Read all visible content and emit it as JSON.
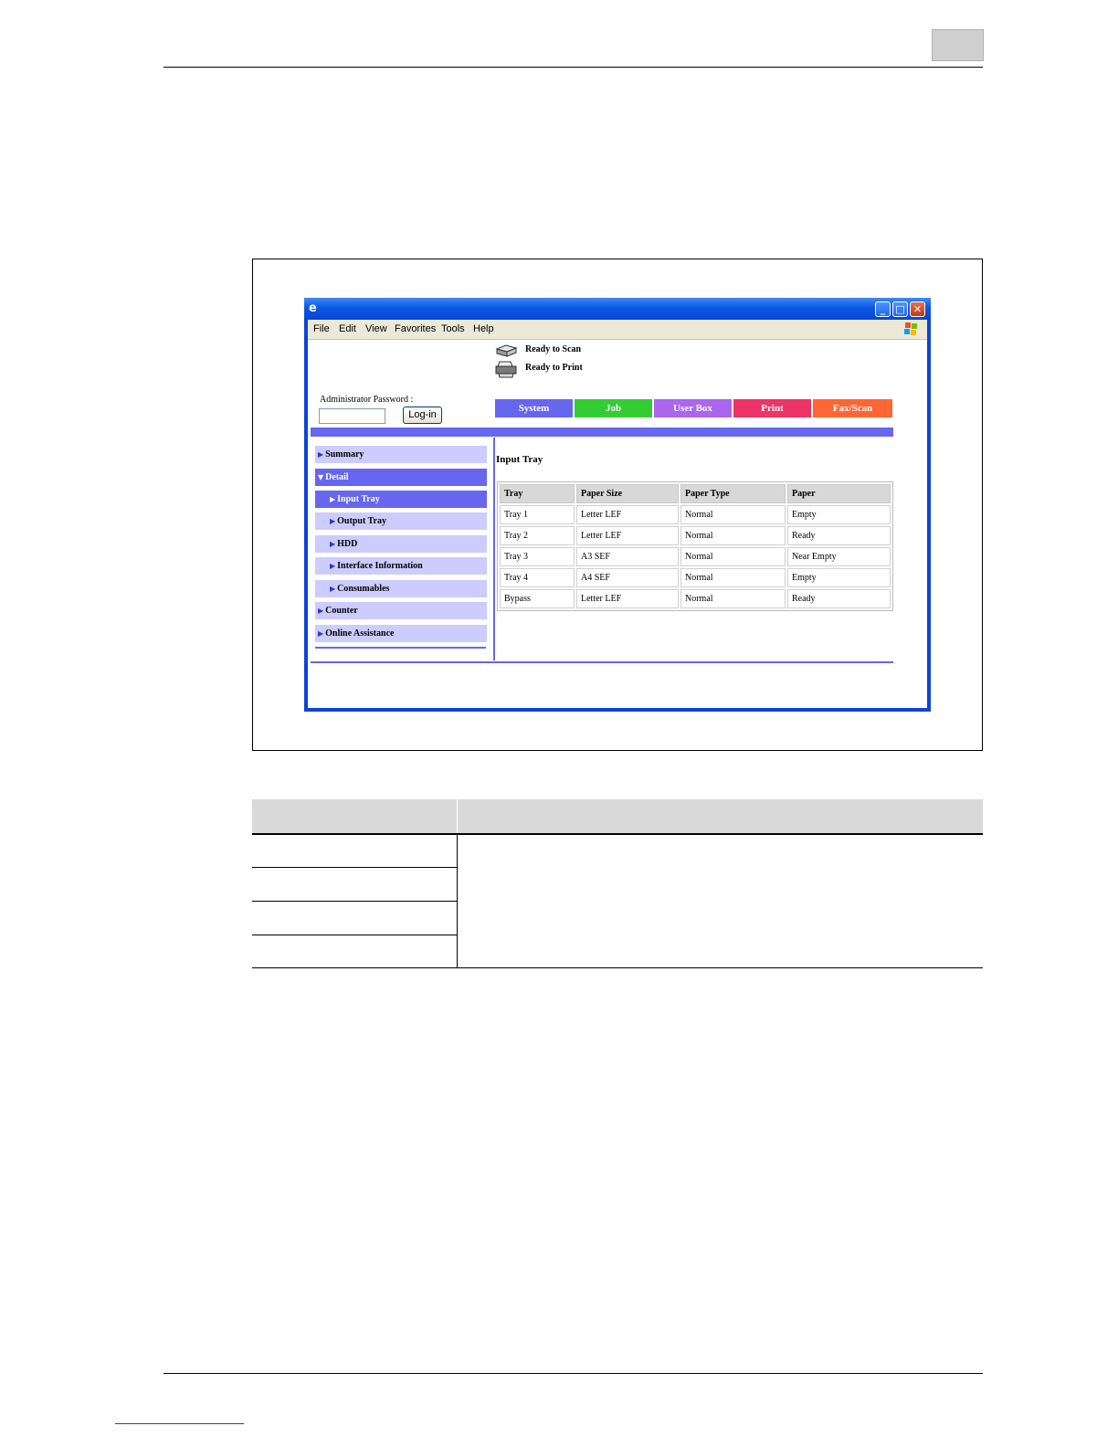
{
  "browser": {
    "menu": [
      "File",
      "Edit",
      "View",
      "Favorites",
      "Tools",
      "Help"
    ],
    "status": [
      {
        "icon": "scanner-icon",
        "text": "Ready to Scan"
      },
      {
        "icon": "printer-icon",
        "text": "Ready to Print"
      }
    ],
    "login": {
      "label": "Administrator Password :",
      "button": "Log-in",
      "value": ""
    },
    "tabs": [
      {
        "label": "System",
        "color": "#6666ee"
      },
      {
        "label": "Job",
        "color": "#33cc33"
      },
      {
        "label": "User Box",
        "color": "#aa66ee"
      },
      {
        "label": "Print",
        "color": "#ee3366"
      },
      {
        "label": "Fax/Scan",
        "color": "#ff6633"
      }
    ],
    "sidebar": {
      "summary": "Summary",
      "detail": "Detail",
      "input_tray": "Input Tray",
      "output_tray": "Output Tray",
      "hdd": "HDD",
      "interface_information": "Interface Information",
      "consumables": "Consumables",
      "counter": "Counter",
      "online_assistance": "Online Assistance"
    },
    "page_title": "Input Tray",
    "table": {
      "headers": [
        "Tray",
        "Paper Size",
        "Paper Type",
        "Paper"
      ],
      "rows": [
        [
          "Tray 1",
          "Letter LEF",
          "Normal",
          "Empty"
        ],
        [
          "Tray 2",
          "Letter LEF",
          "Normal",
          "Ready"
        ],
        [
          "Tray 3",
          "A3 SEF",
          "Normal",
          "Near Empty"
        ],
        [
          "Tray 4",
          "A4 SEF",
          "Normal",
          "Empty"
        ],
        [
          "Bypass",
          "Letter LEF",
          "Normal",
          "Ready"
        ]
      ]
    }
  }
}
